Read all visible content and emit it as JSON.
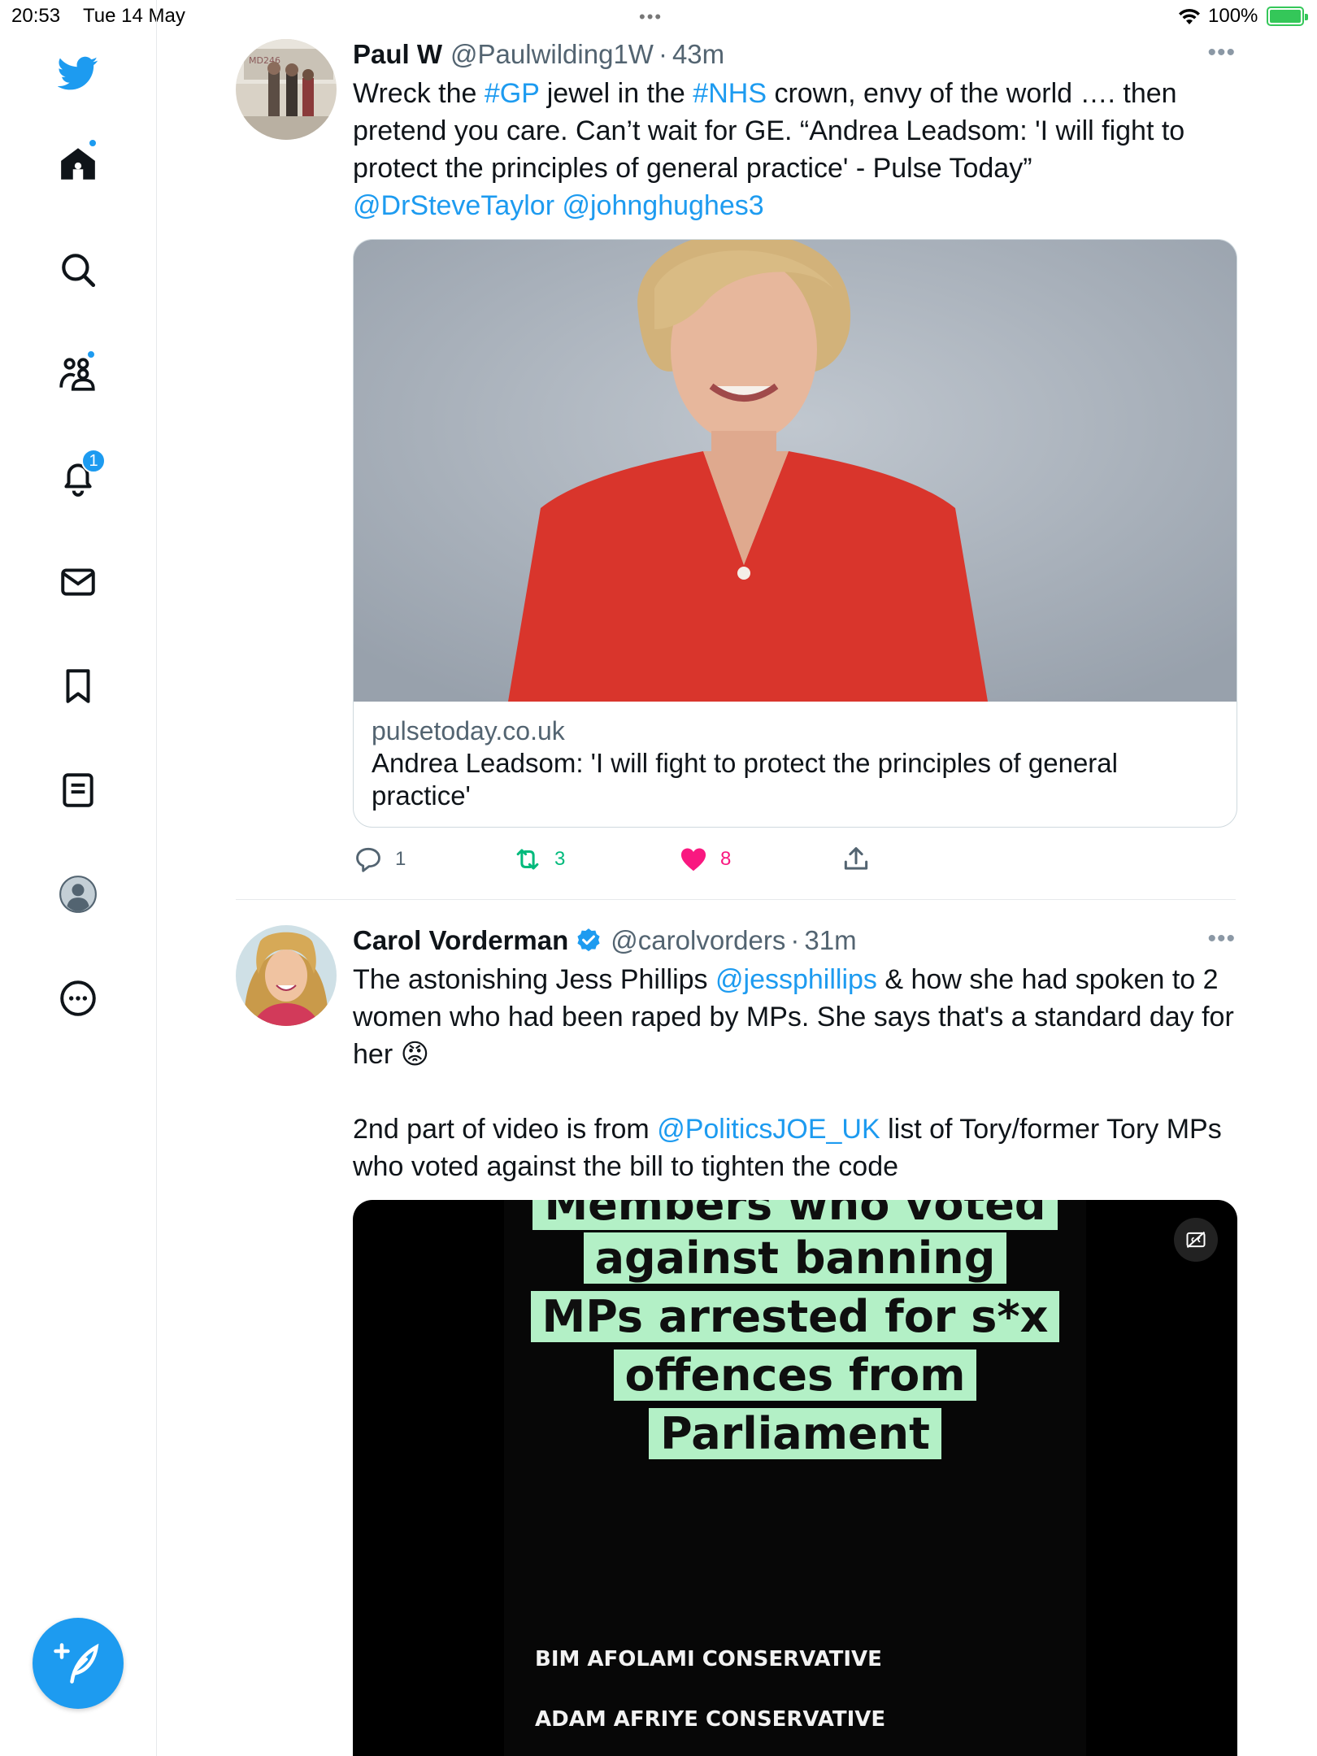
{
  "status_bar": {
    "time": "20:53",
    "date": "Tue 14 May",
    "multitasking_dots": "•••",
    "battery_percent": "100%"
  },
  "sidebar": {
    "items": [
      {
        "name": "logo",
        "icon": "twitter-bird-icon"
      },
      {
        "name": "home",
        "icon": "home-icon",
        "dot": true
      },
      {
        "name": "explore",
        "icon": "search-icon"
      },
      {
        "name": "communities",
        "icon": "communities-icon",
        "dot": true
      },
      {
        "name": "notifications",
        "icon": "bell-icon",
        "badge": "1"
      },
      {
        "name": "messages",
        "icon": "envelope-icon"
      },
      {
        "name": "bookmarks",
        "icon": "bookmark-icon"
      },
      {
        "name": "lists",
        "icon": "list-icon"
      },
      {
        "name": "profile",
        "icon": "profile-avatar-icon"
      },
      {
        "name": "more",
        "icon": "more-circle-icon"
      }
    ],
    "compose_icon": "compose-feather-icon"
  },
  "colors": {
    "accent": "#1d9bf0",
    "retweet": "#00ba7c",
    "like": "#f91880",
    "text_secondary": "#536471",
    "caption_highlight": "#b3f0c6"
  },
  "tweets": [
    {
      "name": "Paul W",
      "handle": "@Paulwilding1W",
      "separator": "·",
      "time": "43m",
      "more": "•••",
      "text_parts": [
        "Wreck the ",
        "#GP",
        " jewel in the ",
        "#NHS",
        " crown, envy of the world …. then pretend you care. Can’t wait for GE. “Andrea Leadsom: 'I will fight to protect the principles of general practice' - Pulse Today”",
        "@DrSteveTaylor",
        "@johnghughes3"
      ],
      "card": {
        "domain": "pulsetoday.co.uk",
        "title": "Andrea Leadsom: 'I will fight to protect the principles of general practice'"
      },
      "replies": "1",
      "retweets": "3",
      "likes": "8",
      "liked": true
    },
    {
      "name": "Carol Vorderman",
      "handle": "@carolvorders",
      "separator": "·",
      "time": "31m",
      "more": "•••",
      "verified": true,
      "text_parts": [
        "The astonishing Jess Phillips ",
        "@jessphillips",
        " & how she had spoken to 2 women who had been raped by MPs. She says that's a standard day for her ",
        "😡",
        "2nd part of video is from ",
        "@PoliticsJOE_UK",
        " list of Tory/former Tory MPs who voted against the bill to tighten the code"
      ],
      "video": {
        "caption_lines": [
          "Members who voted",
          "against banning",
          "MPs arrested for s*x",
          "offences from",
          "Parliament"
        ],
        "credits": [
          "BIM AFOLAMI CONSERVATIVE",
          "ADAM AFRIYE CONSERVATIVE"
        ]
      }
    }
  ]
}
